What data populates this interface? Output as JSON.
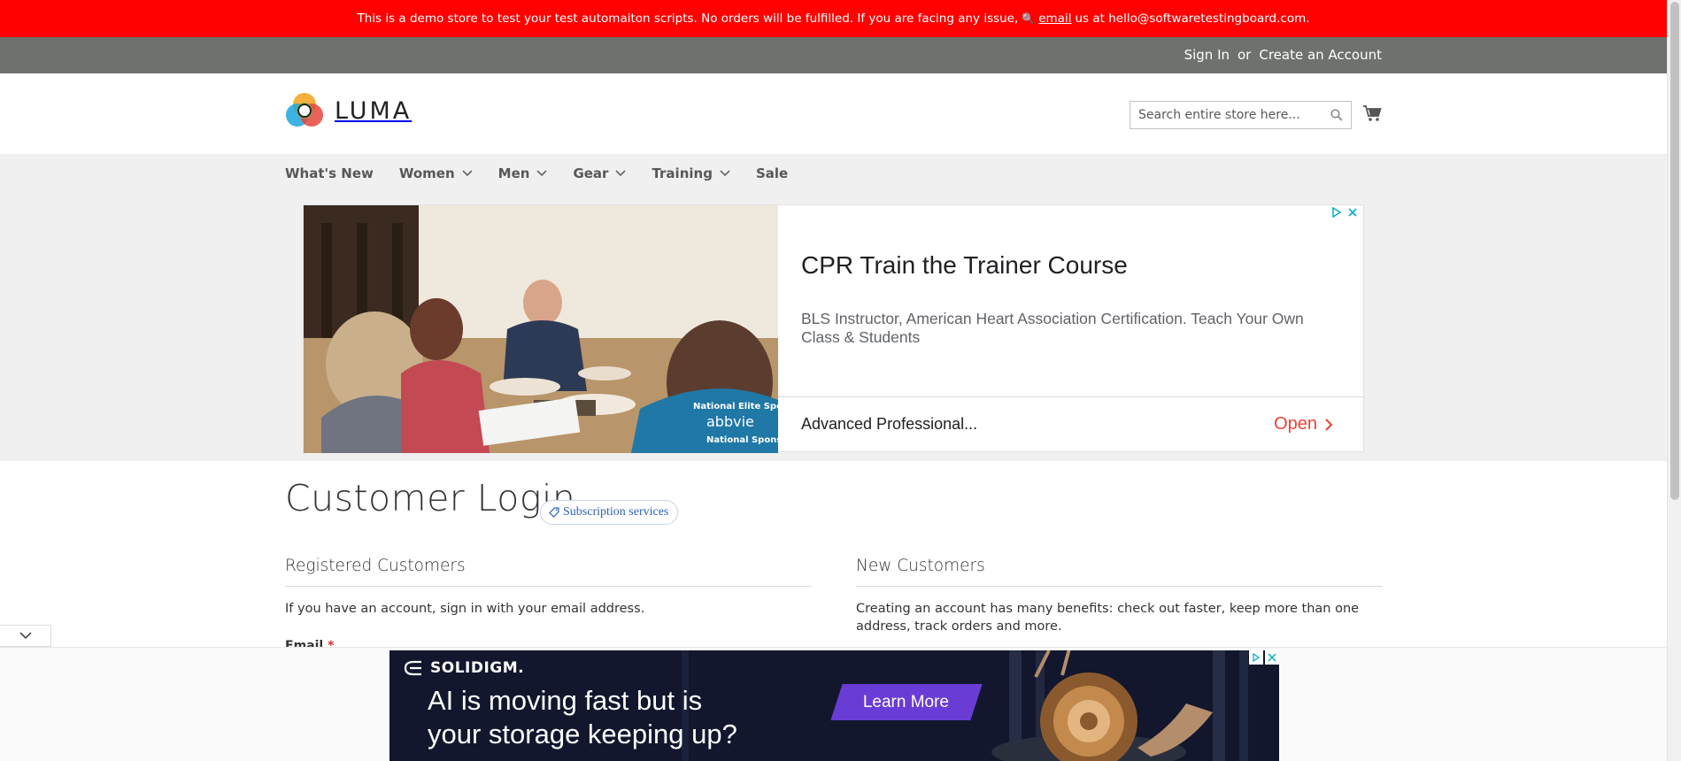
{
  "demo_notice": {
    "text_before": "This is a demo store to test your test automaiton scripts. No orders will be fulfilled. If you are facing any issue,",
    "link": "email",
    "text_after": "us at hello@softwaretestingboard.com."
  },
  "account_bar": {
    "sign_in": "Sign In",
    "separator": "or",
    "create_account": "Create an Account"
  },
  "header": {
    "logo_text": "LUMA",
    "search_placeholder": "Search entire store here..."
  },
  "nav": {
    "items": [
      {
        "label": "What's New",
        "has_dropdown": false
      },
      {
        "label": "Women",
        "has_dropdown": true
      },
      {
        "label": "Men",
        "has_dropdown": true
      },
      {
        "label": "Gear",
        "has_dropdown": true
      },
      {
        "label": "Training",
        "has_dropdown": true
      },
      {
        "label": "Sale",
        "has_dropdown": false
      }
    ]
  },
  "ad": {
    "title": "CPR Train the Trainer Course",
    "description": "BLS Instructor, American Heart Association Certification. Teach Your Own Class & Students",
    "footer_text": "Advanced Professional...",
    "open_label": "Open",
    "shirt_text_1": "National Elite Sponsor",
    "shirt_text_2": "abbvie",
    "shirt_text_3": "National Sponsors"
  },
  "page": {
    "title": "Customer Login",
    "badge": "Subscription services"
  },
  "registered": {
    "title": "Registered Customers",
    "text": "If you have an account, sign in with your email address.",
    "email_label": "Email",
    "required_mark": "*"
  },
  "new_customers": {
    "title": "New Customers",
    "text": "Creating an account has many benefits: check out faster, keep more than one address, track orders and more."
  },
  "bottom_ad": {
    "brand": "SOLIDIGM.",
    "headline_1": "AI is moving fast but is",
    "headline_2": "your storage keeping up?",
    "cta": "Learn More"
  },
  "colors": {
    "notice_bg": "#ff0101",
    "account_bar_bg": "#6e716e",
    "nav_bg": "#f0f0f0",
    "ad_open": "#e94235",
    "badge_text": "#2b63b7",
    "bottom_ad_bg": "#12172d",
    "cta_bg": "#6a3cd6"
  }
}
